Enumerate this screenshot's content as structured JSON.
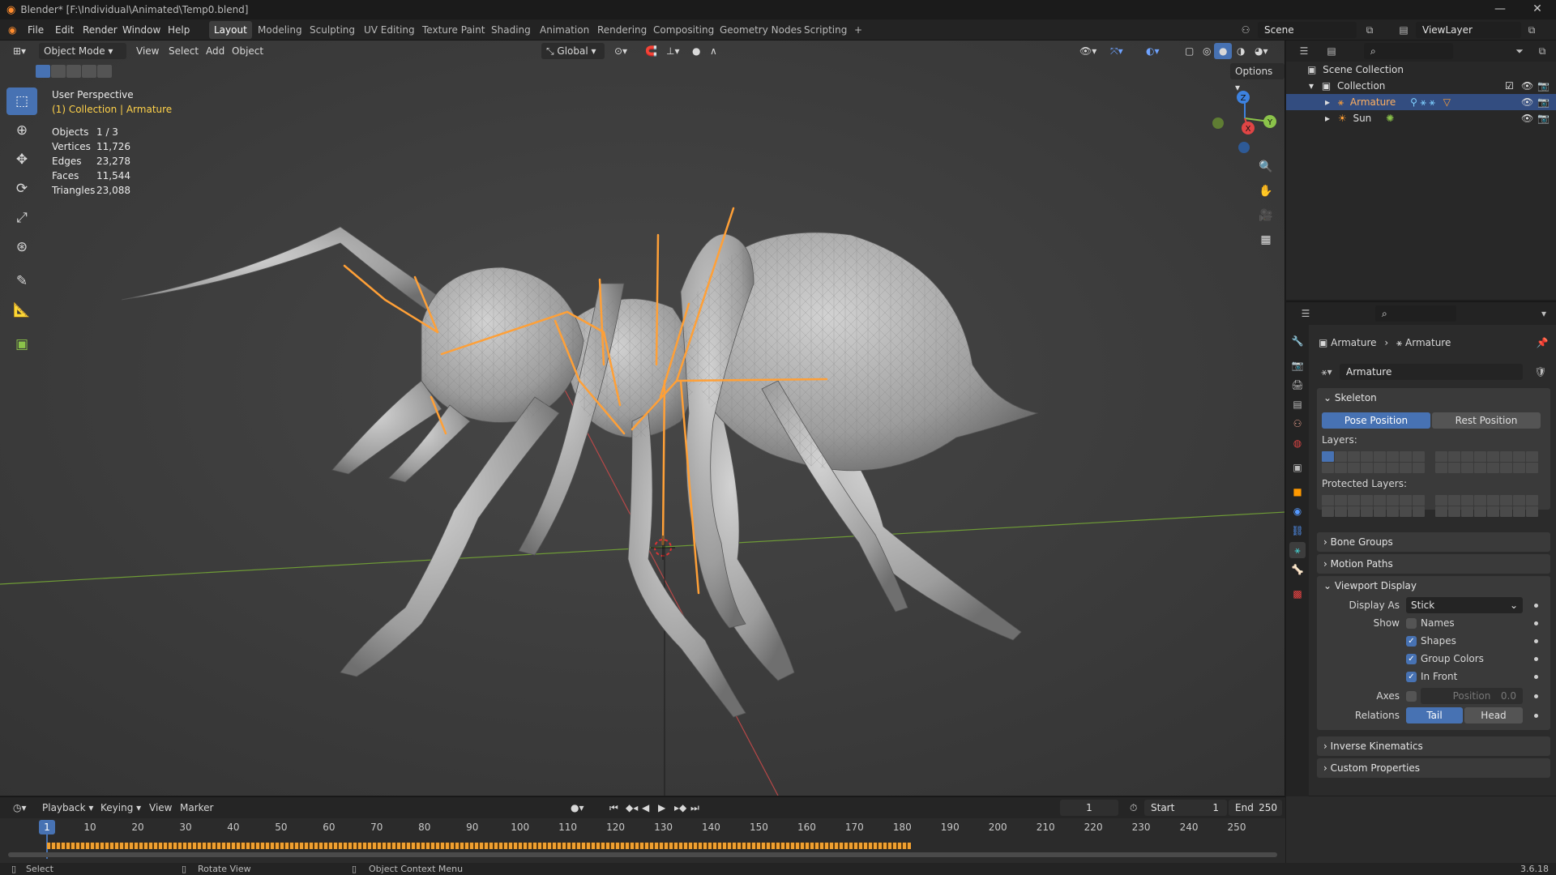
{
  "app": {
    "title": "Blender* [F:\\Individual\\Animated\\Temp0.blend]",
    "version": "3.6.18",
    "accent": "#4772b3",
    "bone_color": "#ffa037"
  },
  "menu": [
    "File",
    "Edit",
    "Render",
    "Window",
    "Help"
  ],
  "workspaces": [
    "Layout",
    "Modeling",
    "Sculpting",
    "UV Editing",
    "Texture Paint",
    "Shading",
    "Animation",
    "Rendering",
    "Compositing",
    "Geometry Nodes",
    "Scripting",
    "+"
  ],
  "scene": {
    "label": "Scene",
    "view_layer": "ViewLayer"
  },
  "viewport": {
    "mode": "Object Mode",
    "menus": [
      "View",
      "Select",
      "Add",
      "Object"
    ],
    "orientation": "Global",
    "options": "Options",
    "perspective": "User Perspective",
    "context": "(1) Collection | Armature",
    "stats": [
      {
        "k": "Objects",
        "v": "1 / 3"
      },
      {
        "k": "Vertices",
        "v": "11,726"
      },
      {
        "k": "Edges",
        "v": "23,278"
      },
      {
        "k": "Faces",
        "v": "11,544"
      },
      {
        "k": "Triangles",
        "v": "23,088"
      }
    ],
    "axes": {
      "x": "X",
      "y": "Y",
      "z": "Z"
    }
  },
  "outliner": {
    "root": "Scene Collection",
    "collection": "Collection",
    "items": [
      {
        "name": "Armature",
        "selected": true
      },
      {
        "name": "Sun",
        "selected": false
      }
    ]
  },
  "properties": {
    "breadcrumb_a": "Armature",
    "breadcrumb_b": "Armature",
    "data_name": "Armature",
    "skeleton": {
      "title": "Skeleton",
      "pose": "Pose Position",
      "rest": "Rest Position",
      "layers_label": "Layers:",
      "protected_label": "Protected Layers:"
    },
    "collapsed_a": [
      "Bone Groups",
      "Motion Paths"
    ],
    "viewport_display": {
      "title": "Viewport Display",
      "display_as_label": "Display As",
      "display_as": "Stick",
      "show_label": "Show",
      "names": "Names",
      "shapes": "Shapes",
      "group_colors": "Group Colors",
      "in_front": "In Front",
      "axes_label": "Axes",
      "position_label": "Position",
      "position_value": "0.0",
      "relations_label": "Relations",
      "tail": "Tail",
      "head": "Head"
    },
    "collapsed_b": [
      "Inverse Kinematics",
      "Custom Properties"
    ]
  },
  "timeline": {
    "menus": [
      "Playback",
      "Keying",
      "View",
      "Marker"
    ],
    "current_frame": "1",
    "start_label": "Start",
    "start": "1",
    "end_label": "End",
    "end": "250",
    "ticks": [
      "1",
      "10",
      "20",
      "30",
      "40",
      "50",
      "60",
      "70",
      "80",
      "90",
      "100",
      "110",
      "120",
      "130",
      "140",
      "150",
      "160",
      "170",
      "180",
      "190",
      "200",
      "210",
      "220",
      "230",
      "240",
      "250"
    ]
  },
  "status": {
    "select": "Select",
    "rotate": "Rotate View",
    "context": "Object Context Menu"
  }
}
